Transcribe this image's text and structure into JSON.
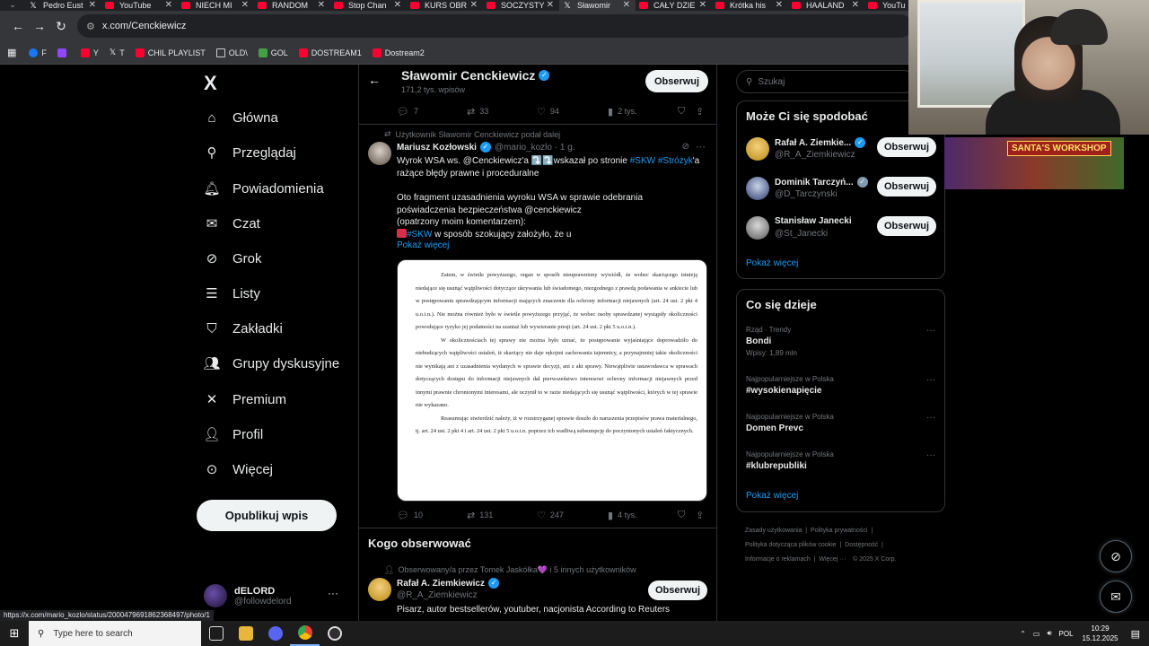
{
  "browser": {
    "tabs": [
      {
        "title": "Pedro Eust",
        "icon": "x-icon",
        "active": false
      },
      {
        "title": "YouTube",
        "icon": "youtube-icon",
        "active": false
      },
      {
        "title": "NIECH MI",
        "icon": "youtube-icon",
        "active": false
      },
      {
        "title": "RANDOM",
        "icon": "youtube-icon",
        "active": false
      },
      {
        "title": "Stop Chan",
        "icon": "youtube-icon",
        "active": false
      },
      {
        "title": "KURS OBR",
        "icon": "youtube-icon",
        "active": false
      },
      {
        "title": "SOCZYSTY",
        "icon": "youtube-icon",
        "active": false
      },
      {
        "title": "Sławomir",
        "icon": "x-icon",
        "active": true
      },
      {
        "title": "CAŁY DZIE",
        "icon": "youtube-icon",
        "active": false
      },
      {
        "title": "Krótka his",
        "icon": "youtube-icon",
        "active": false
      },
      {
        "title": "HAALAND",
        "icon": "youtube-icon",
        "active": false
      },
      {
        "title": "YouTu",
        "icon": "youtube-icon",
        "active": false
      }
    ],
    "url": "x.com/Cenckiewicz",
    "bookmarks": [
      {
        "label": "F",
        "icon": "facebook-icon"
      },
      {
        "label": "",
        "icon": "twitch-icon"
      },
      {
        "label": "Y",
        "icon": "youtube-icon"
      },
      {
        "label": "T",
        "icon": "x-icon"
      },
      {
        "label": "CHIL PLAYLIST",
        "icon": "youtube-icon"
      },
      {
        "label": "OLD\\",
        "icon": "folder-icon"
      },
      {
        "label": "GOL",
        "icon": "gol-icon"
      },
      {
        "label": "DOSTREAM1",
        "icon": "youtube-icon"
      },
      {
        "label": "Dostream2",
        "icon": "youtube-icon"
      }
    ],
    "status_url": "https://x.com/mario_kozlo/status/2000479691862368497/photo/1"
  },
  "nav": {
    "logo": "X",
    "items": [
      {
        "label": "Główna",
        "icon": "home-icon",
        "glyph": "⌂"
      },
      {
        "label": "Przeglądaj",
        "icon": "search-icon",
        "glyph": "⚲"
      },
      {
        "label": "Powiadomienia",
        "icon": "bell-icon",
        "glyph": "🔔︎"
      },
      {
        "label": "Czat",
        "icon": "mail-icon",
        "glyph": "✉"
      },
      {
        "label": "Grok",
        "icon": "grok-icon",
        "glyph": "⊘"
      },
      {
        "label": "Listy",
        "icon": "list-icon",
        "glyph": "☰"
      },
      {
        "label": "Zakładki",
        "icon": "bookmark-icon",
        "glyph": "⛉"
      },
      {
        "label": "Grupy dyskusyjne",
        "icon": "communities-icon",
        "glyph": "👥︎"
      },
      {
        "label": "Premium",
        "icon": "x-premium-icon",
        "glyph": "✕"
      },
      {
        "label": "Profil",
        "icon": "profile-icon",
        "glyph": "👤︎"
      },
      {
        "label": "Więcej",
        "icon": "more-icon",
        "glyph": "⊙"
      }
    ],
    "post_button": "Opublikuj wpis",
    "account": {
      "name": "dELORD",
      "handle": "@followdelord"
    }
  },
  "profile_header": {
    "name": "Sławomir Cenckiewicz",
    "posts_count": "171,2 tys. wpisów",
    "follow_label": "Obserwuj"
  },
  "prev_tweet_stats": {
    "replies": "7",
    "reposts": "33",
    "likes": "94",
    "views": "2 tys."
  },
  "tweet": {
    "repost_note": "Użytkownik Sławomir Cenckiewicz podał dalej",
    "author_name": "Mariusz Kozłowski",
    "author_handle": "@mario_kozlo · 1 g.",
    "line1_a": "Wyrok WSA  ws. @Cenckiewicz'a ⤵️⤵️wskazał po stronie ",
    "line1_h1": "#SKW",
    "line1_h2": "#Stróżyk",
    "line1_b": "'a",
    "line2": "rażące błędy prawne i proceduralne",
    "line3": "Oto fragment uzasadnienia wyroku WSA w sprawie odebrania",
    "line4": "poświadczenia bezpieczeństwa @cenckiewicz",
    "line5": "(opatrzony moim komentarzem):",
    "line6_h": "#SKW",
    "line6_b": " w sposób szokujący założyło, że u",
    "show_more": "Pokaż więcej",
    "doc_paragraphs": [
      "Zatem, w świetle powyższego, organ w sposób nieuprawniony wywiódł, że wobec skarżącego istnieją niedające się usunąć wątpliwości dotyczące ukrywania lub świadomego, niezgodnego z prawdą podawania w ankiecie lub w postępowaniu sprawdzającym informacji mających znaczenie dla ochrony informacji niejawnych (art. 24 ust. 2 pkt 4 u.o.i.n.). Nie można również było w świetle powyższego przyjąć, że wobec osoby sprawdzanej wystąpiły okoliczności powodujące ryzyko jej podatności na szantaż lub wywieranie presji (art. 24 ust. 2 pkt 5 u.o.i.n.).",
      "W okolicznościach tej sprawy nie można było uznać, że postępowanie wyjaśniające doprowadziło do niebudzących wątpliwości ustaleń, iż skarżący nie daje rękojmi zachowania tajemnicy, a przynajmniej takie okoliczności nie wynikają ani z uzasadnienia wydanych w sprawie decyzji, ani z akt sprawy. Niewątpliwie ustawodawca w sprawach dotyczących dostępu do informacji niejawnych dał pierwszeństwo interesowi ochrony informacji niejawnych przed innymi prawnie chronionymi interesami, ale uczynił to w razie niedających się usunąć wątpliwości, których w tej sprawie nie wykazano.",
      "Reasumując stwierdzić należy, iż w rozstrzyganej sprawie doszło do naruszenia przepisów prawa materialnego, tj. art. 24 ust. 2 pkt 4 i art. 24 ust. 2 pkt 5 u.o.i.n. poprzez ich wadliwą subsumpcję do poczynionych ustaleń faktycznych."
    ],
    "stats": {
      "replies": "10",
      "reposts": "131",
      "likes": "247",
      "views": "4 tys."
    }
  },
  "who_to_follow": {
    "title": "Kogo obserwować",
    "note": "Obserwowany/a przez Tomek Jaskółka💜 i 5 innych użytkowników",
    "name": "Rafał A. Ziemkiewicz",
    "handle": "@R_A_Ziemkiewicz",
    "bio": "Pisarz, autor bestsellerów, youtuber, nacjonista According to Reuters",
    "follow_label": "Obserwuj"
  },
  "right": {
    "search_placeholder": "Szukaj",
    "suggest_title": "Może Ci się spodobać",
    "suggestions": [
      {
        "name": "Rafał A. Ziemkie...",
        "handle": "@R_A_Ziemkiewicz",
        "follow": "Obserwuj",
        "badge": "blue"
      },
      {
        "name": "Dominik Tarczyń...",
        "handle": "@D_Tarczynski",
        "follow": "Obserwuj",
        "badge": "grey"
      },
      {
        "name": "Stanisław Janecki",
        "handle": "@St_Janecki",
        "follow": "Obserwuj",
        "badge": "none"
      }
    ],
    "show_more": "Pokaż więcej",
    "trends_title": "Co się dzieje",
    "trends": [
      {
        "meta": "Rząd · Trendy",
        "topic": "Bondi",
        "count": "Wpisy: 1,89 mln"
      },
      {
        "meta": "Najpopularniejsze w Polska",
        "topic": "#wysokienapięcie",
        "count": ""
      },
      {
        "meta": "Najpopularniejsze w Polska",
        "topic": "Domen Prevc",
        "count": ""
      },
      {
        "meta": "Najpopularniejsze w Polska",
        "topic": "#klubrepubliki",
        "count": ""
      }
    ],
    "trends_show_more": "Pokaż więcej",
    "footer": {
      "l1a": "Zasady użytkowania",
      "l1b": "Polityka prywatności",
      "l2a": "Polityka dotycząca plików cookie",
      "l2b": "Dostępność",
      "l3a": "Informacje o reklamach",
      "l3b": "Więcej ···",
      "l3c": "© 2025 X Corp."
    }
  },
  "overlay": {
    "text": "SANTA'S WORKSHOP"
  },
  "taskbar": {
    "search_placeholder": "Type here to search",
    "lang": "POL",
    "time": "10:29",
    "date": "15.12.2025"
  }
}
